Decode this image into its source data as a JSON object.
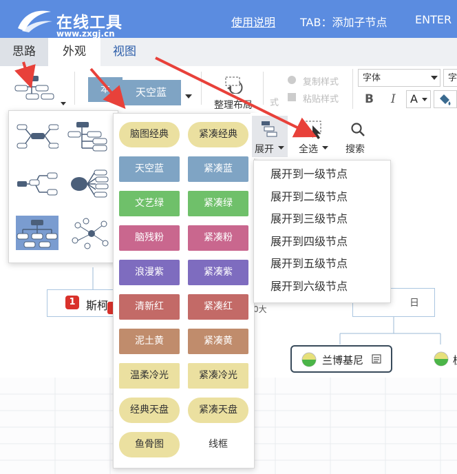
{
  "header": {
    "logo_text": "在线工具",
    "logo_url": "www.zxgj.cn",
    "help_link": "使用说明",
    "tab_hint": "TAB：添加子节点",
    "enter_hint": "ENTER"
  },
  "tabs": [
    {
      "label": "思路"
    },
    {
      "label": "外观"
    },
    {
      "label": "视图"
    }
  ],
  "toolbar": {
    "theme_current": "天空蓝",
    "theme_back_partial": "本",
    "arrange_label": "整理布局",
    "copy_style": "复制样式",
    "paste_style": "粘贴样式",
    "font_select": "字体",
    "font_select2": "字",
    "bold": "B",
    "italic": "I",
    "font_color": "A",
    "expand_label": "展开",
    "select_all_label": "全选",
    "search_label": "搜索",
    "sidebar_partial": "式"
  },
  "canvas": {
    "node_left_badge": "1",
    "node_left_text": "斯柯",
    "node_center": "兰博基尼",
    "node_partial_right": "日",
    "node_partial_mid": "0大",
    "node_far_right": "桂"
  },
  "theme_menu": {
    "items": [
      {
        "label": "脑图经典",
        "bg": "#ebe0a0",
        "color": "#333"
      },
      {
        "label": "紧凑经典",
        "bg": "#ebe0a0",
        "color": "#333"
      },
      {
        "label": "天空蓝",
        "bg": "#7fa4c4",
        "color": "#fff"
      },
      {
        "label": "紧凑蓝",
        "bg": "#7fa4c4",
        "color": "#fff"
      },
      {
        "label": "文艺绿",
        "bg": "#6fc06a",
        "color": "#fff"
      },
      {
        "label": "紧凑绿",
        "bg": "#6fc06a",
        "color": "#fff"
      },
      {
        "label": "脑残粉",
        "bg": "#c9678e",
        "color": "#fff"
      },
      {
        "label": "紧凑粉",
        "bg": "#c9678e",
        "color": "#fff"
      },
      {
        "label": "浪漫紫",
        "bg": "#7e6cbf",
        "color": "#fff"
      },
      {
        "label": "紧凑紫",
        "bg": "#7e6cbf",
        "color": "#fff"
      },
      {
        "label": "清新红",
        "bg": "#c36a67",
        "color": "#fff"
      },
      {
        "label": "紧凑红",
        "bg": "#c36a67",
        "color": "#fff"
      },
      {
        "label": "泥土黄",
        "bg": "#c08c6c",
        "color": "#fff"
      },
      {
        "label": "紧凑黄",
        "bg": "#c08c6c",
        "color": "#fff"
      },
      {
        "label": "温柔冷光",
        "bg": "#ebe0a0",
        "color": "#333"
      },
      {
        "label": "紧凑冷光",
        "bg": "#ebe0a0",
        "color": "#333"
      },
      {
        "label": "经典天盘",
        "bg": "#ebe0a0",
        "color": "#333"
      },
      {
        "label": "紧凑天盘",
        "bg": "#ebe0a0",
        "color": "#333"
      },
      {
        "label": "鱼骨图",
        "bg": "#ebe0a0",
        "color": "#333"
      },
      {
        "label": "线框",
        "bg": "#ffffff",
        "color": "#333"
      }
    ]
  },
  "expand_menu": {
    "items": [
      {
        "label": "展开到一级节点"
      },
      {
        "label": "展开到二级节点"
      },
      {
        "label": "展开到三级节点"
      },
      {
        "label": "展开到四级节点"
      },
      {
        "label": "展开到五级节点"
      },
      {
        "label": "展开到六级节点"
      }
    ]
  },
  "colors": {
    "header_bg": "#5b8ce0",
    "arrow": "#e8413a",
    "selected_layout": "#7a9cd0"
  }
}
